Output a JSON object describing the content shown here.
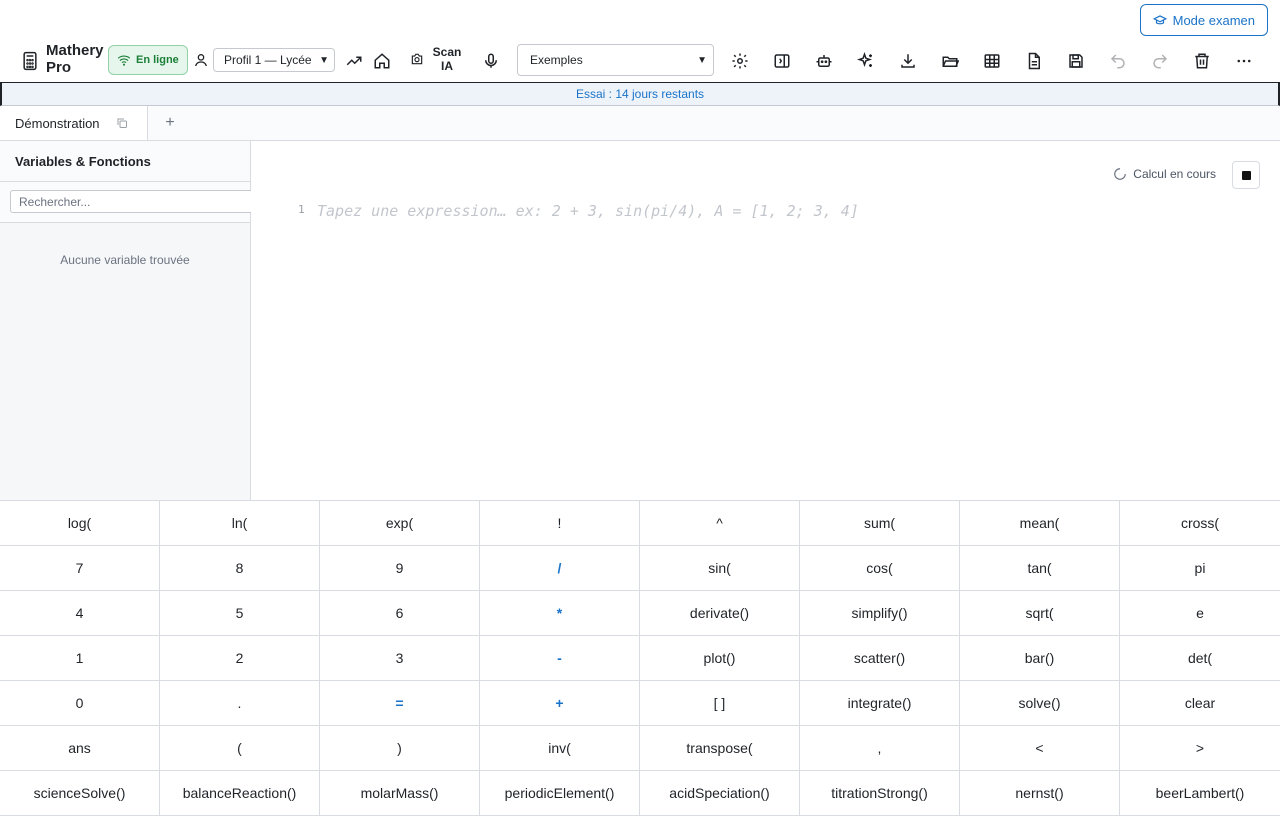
{
  "header": {
    "exam_mode_label": "Mode examen",
    "app_name": "Mathery Pro",
    "online_label": "En ligne",
    "profile_select": "Profil 1 — Lycée",
    "scan_label": "Scan IA",
    "examples_select": "Exemples"
  },
  "trial_banner": "Essai : 14 jours restants",
  "tabs": [
    {
      "label": "Démonstration"
    }
  ],
  "sidebar": {
    "title": "Variables & Fonctions",
    "search_placeholder": "Rechercher...",
    "empty_message": "Aucune variable trouvée"
  },
  "editor": {
    "status": "Calcul en cours",
    "line_number": "1",
    "placeholder": "Tapez une expression… ex: 2 + 3, sin(pi/4), A = [1, 2; 3, 4]"
  },
  "keypad": {
    "keys": [
      "log(",
      "ln(",
      "exp(",
      "!",
      "^",
      "sum(",
      "mean(",
      "cross(",
      "7",
      "8",
      "9",
      "/",
      "sin(",
      "cos(",
      "tan(",
      "pi",
      "4",
      "5",
      "6",
      "*",
      "derivate()",
      "simplify()",
      "sqrt(",
      "e",
      "1",
      "2",
      "3",
      "-",
      "plot()",
      "scatter()",
      "bar()",
      "det(",
      "0",
      ".",
      "=",
      "+",
      "[ ]",
      "integrate()",
      "solve()",
      "clear",
      "ans",
      "(",
      ")",
      "inv(",
      "transpose(",
      ",",
      "<",
      ">",
      "scienceSolve()",
      "balanceReaction()",
      "molarMass()",
      "periodicElement()",
      "acidSpeciation()",
      "titrationStrong()",
      "nernst()",
      "beerLambert()"
    ],
    "operator_keys": [
      "/",
      "*",
      "-",
      "=",
      "+"
    ]
  },
  "colors": {
    "accent": "#1a73c8",
    "online_green": "#1a7f37"
  }
}
